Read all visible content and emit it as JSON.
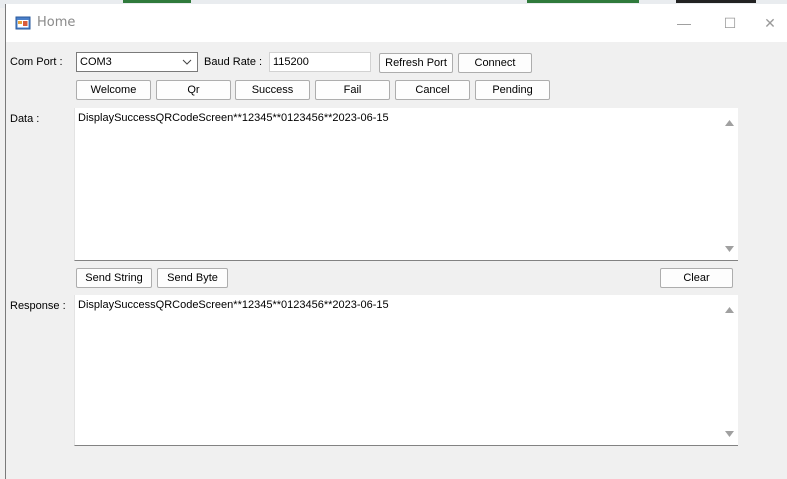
{
  "window": {
    "title": "Home"
  },
  "controls": {
    "minimize": "—",
    "maximize": "☐",
    "close": "✕"
  },
  "connection": {
    "com_port_label": "Com Port :",
    "com_port_value": "COM3",
    "baud_rate_label": "Baud Rate :",
    "baud_rate_value": "115200",
    "refresh_port_label": "Refresh Port",
    "connect_label": "Connect"
  },
  "screen_buttons": [
    "Welcome",
    "Qr",
    "Success",
    "Fail",
    "Cancel",
    "Pending"
  ],
  "data_section": {
    "label": "Data :",
    "text": "DisplaySuccessQRCodeScreen**12345**0123456**2023-06-15"
  },
  "send_buttons": {
    "send_string": "Send String",
    "send_byte": "Send Byte",
    "clear": "Clear"
  },
  "response_section": {
    "label": "Response :",
    "text": "DisplaySuccessQRCodeScreen**12345**0123456**2023-06-15"
  },
  "icons": {
    "app": "app-window-icon",
    "combo": "chevron-down-icon",
    "scroll_up": "scroll-up-arrow-icon",
    "scroll_down": "scroll-down-arrow-icon"
  }
}
